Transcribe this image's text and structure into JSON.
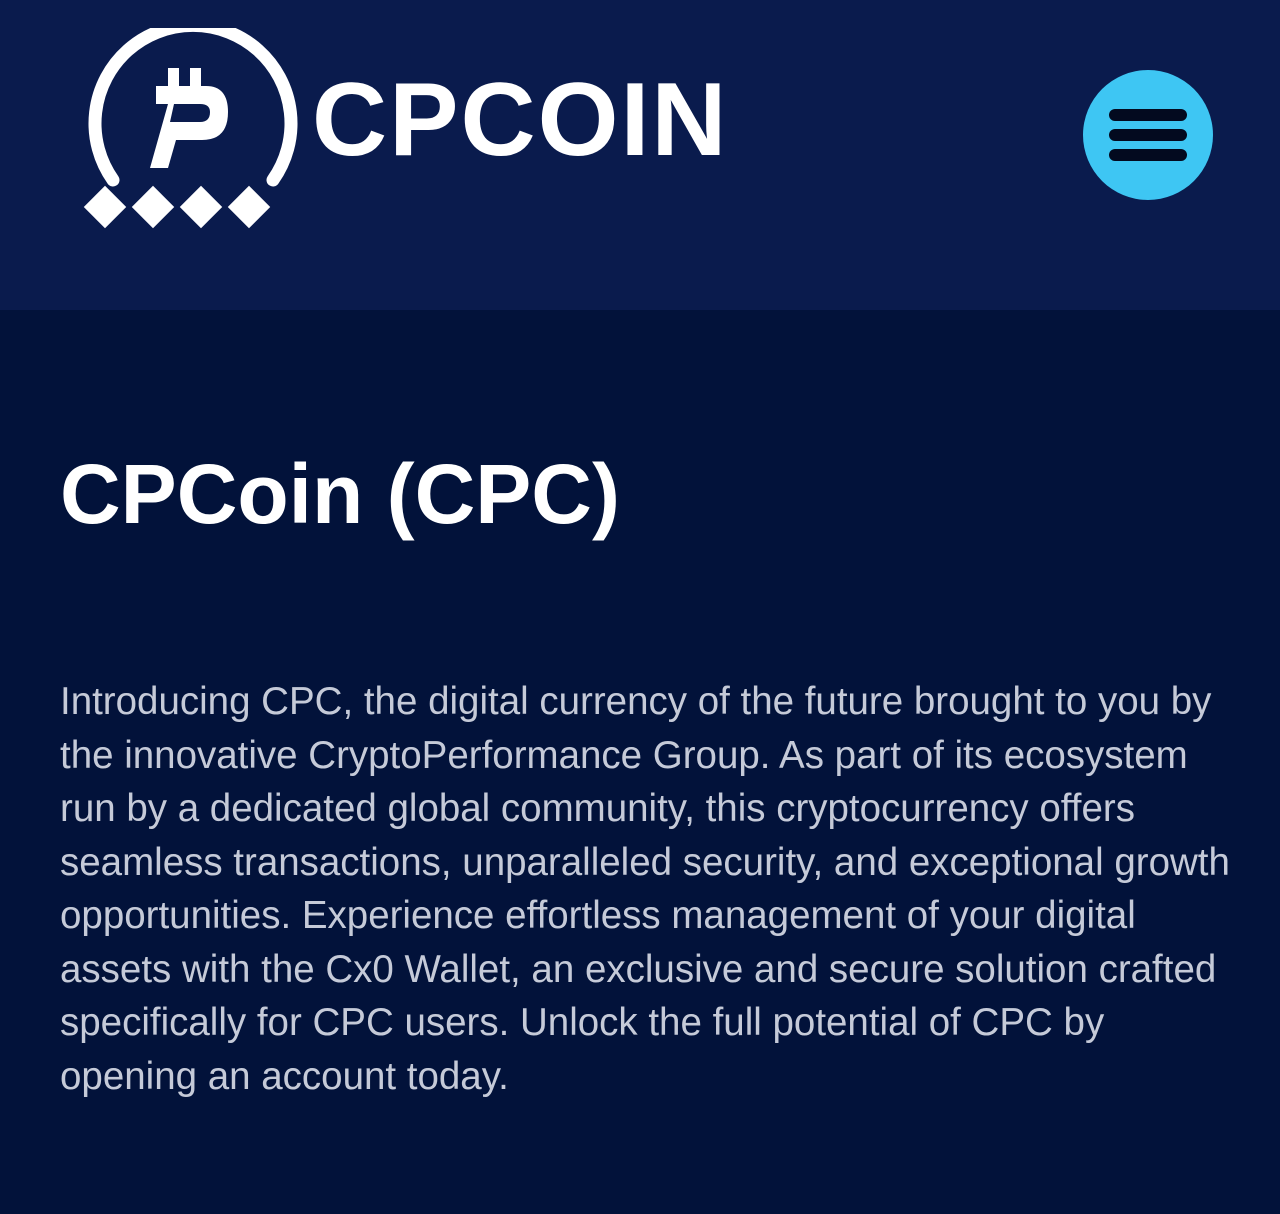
{
  "header": {
    "brand": "CPCOIN",
    "logo_symbol": "₱",
    "logo_icon": "cpcoin-logo-icon",
    "menu_icon": "hamburger-menu-icon"
  },
  "main": {
    "title": "CPCoin (CPC)",
    "description": "Introducing CPC, the digital currency of the future brought to you by the innovative CryptoPerformance Group. As part of its ecosystem run by a dedicated global community, this cryptocurrency offers seamless transactions, unparalleled security, and exceptional growth opportunities. Experience effortless management of your digital assets with the Cx0 Wallet, an exclusive and secure solution crafted specifically for CPC users. Unlock the full potential of CPC by opening an account today."
  },
  "colors": {
    "header_bg": "#0a1b4d",
    "page_bg": "#02123a",
    "accent": "#3ec6f3",
    "title_text": "#ffffff",
    "body_text": "#c5cad8"
  }
}
